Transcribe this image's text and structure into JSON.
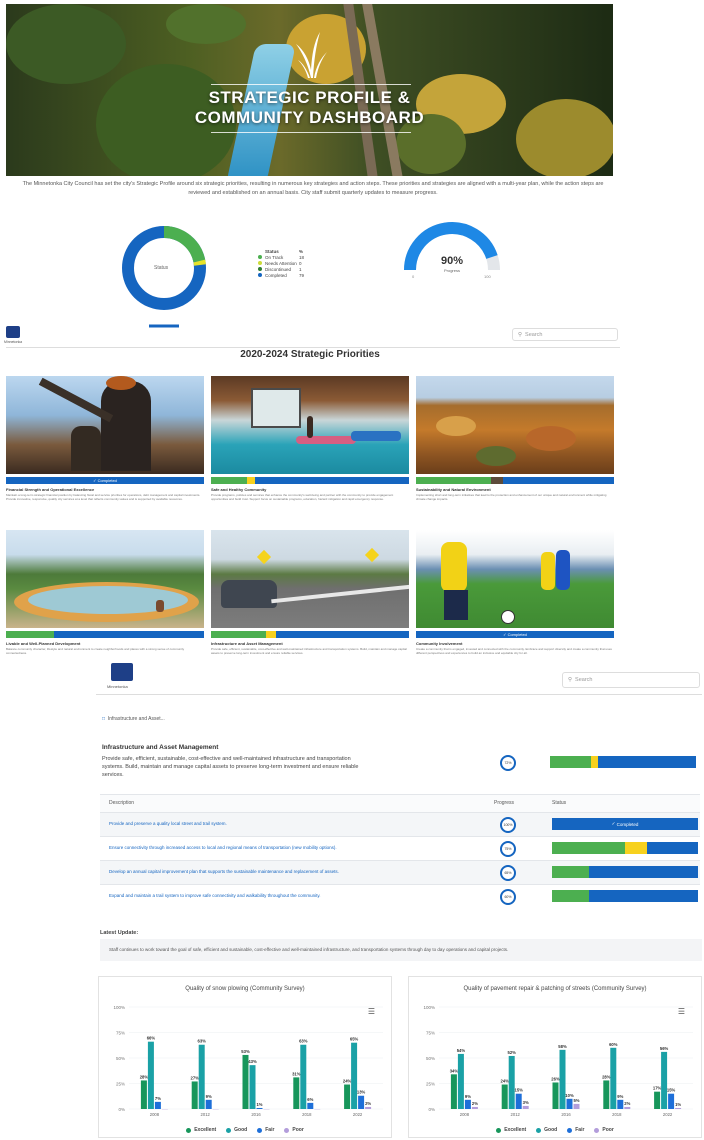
{
  "hero": {
    "title_line1": "STRATEGIC PROFILE &",
    "title_line2": "COMMUNITY DASHBOARD"
  },
  "intro": "The Minnetonka City Council has set the city's Strategic Profile around six strategic priorities, resulting in numerous key strategies and action steps. These priorities and strategies are aligned with a multi-year plan, while the action steps are reviewed and established on an annual basis. City staff submit quarterly updates to measure progress.",
  "status_donut": {
    "center_label": "Status",
    "legend_header": [
      "Status",
      "%"
    ],
    "legend": [
      {
        "label": "On Track",
        "value": "18",
        "color": "#4caf50"
      },
      {
        "label": "Needs Attention",
        "value": "0",
        "color": "#cddc39"
      },
      {
        "label": "Discontinued",
        "value": "1",
        "color": "#2e7d32"
      },
      {
        "label": "Completed",
        "value": "79",
        "color": "#1565c0"
      }
    ]
  },
  "progress_gauge": {
    "value_text": "90%",
    "label": "Progress",
    "min": "0",
    "max": "100",
    "fraction": 0.9
  },
  "site": {
    "logo_text": "Minnetonka",
    "search_placeholder": "Search"
  },
  "priorities": {
    "heading": "2020-2024 Strategic Priorities",
    "cards": [
      {
        "title": "Financial Strength and Operational Excellence",
        "desc": "Maintain a long-term strategic financial position by balancing fiscal and service priorities for operations, debt management and capital investments. Provide innovative, responsive, quality city services at a level that reflects community values and is supported by available resources.",
        "status": "Completed",
        "mode": "complete"
      },
      {
        "title": "Safe and Healthy Community",
        "desc": "Provide programs, policies and services that enhance the community's well-being and partner with the community to provide engagement opportunities and build trust. Support focus on sustainable programs, education, hazard mitigation and rapid emergency response.",
        "status": "",
        "mode": "mixed",
        "green": 0.18,
        "yellow": 0.04
      },
      {
        "title": "Sustainability and Natural Environment",
        "desc": "Implementing short and long-term initiatives that lead to the protection and enhancement of our unique and natural environment while mitigating climate change impacts.",
        "status": "",
        "mode": "mixed",
        "green": 0.38,
        "yellow": 0,
        "dark": 0.06
      },
      {
        "title": "Livable and Well-Planned Development",
        "desc": "Balance community character, lifestyle and natural environment to create neighborhoods and places with a strong sense of community connectedness.",
        "status": "",
        "mode": "mixed",
        "green": 0.24,
        "yellow": 0
      },
      {
        "title": "Infrastructure and Asset Management",
        "desc": "Provide safe, efficient, sustainable, cost-effective and well-maintained infrastructure and transportation systems. Build, maintain and manage capital assets to preserve long-term investment and ensure reliable services.",
        "status": "",
        "mode": "mixed",
        "green": 0.28,
        "yellow": 0.05
      },
      {
        "title": "Community Involvement",
        "desc": "Create a community that is engaged, invested and connected with the community. Embrace and support diversity and create a community that uses different perspectives and experiences to build an inclusive and equitable city for all.",
        "status": "Completed",
        "mode": "complete"
      }
    ]
  },
  "detail": {
    "breadcrumb": "Infrastructure and Asset...",
    "title": "Infrastructure and Asset Management",
    "desc": "Provide safe, efficient, sustainable, cost-effective and well-maintained infrastructure and transportation systems. Build, maintain and manage capital assets to preserve long-term investment and ensure reliable services.",
    "progress": "72%",
    "overall_status": {
      "green": 0.28,
      "yellow": 0.05
    },
    "table_headers": {
      "description": "Description",
      "progress": "Progress",
      "status": "Status"
    },
    "rows": [
      {
        "text": "Provide and preserve a quality local street and trail system.",
        "progress": "100%",
        "status_label": "Completed",
        "mode": "complete"
      },
      {
        "text": "Ensure connectivity through increased access to local and regional means of transportation (new mobility options).",
        "progress": "75%",
        "mode": "mixed",
        "green": 0.5,
        "yellow": 0.15
      },
      {
        "text": "Develop an annual capital improvement plan that supports the sustainable maintenance and replacement of assets.",
        "progress": "65%",
        "mode": "mixed",
        "green": 0.25,
        "yellow": 0
      },
      {
        "text": "Expand and maintain a trail system to improve safe connectivity and walkability throughout the community.",
        "progress": "60%",
        "mode": "mixed",
        "green": 0.25,
        "yellow": 0
      }
    ],
    "latest_label": "Latest Update:",
    "latest_text": "Staff continues to work toward the goal of safe, efficient and sustainable, cost-effective and well-maintained infrastructure, and transportation systems through day to day operations and capital projects."
  },
  "colors": {
    "excellent": "#17965b",
    "good": "#1aa1a6",
    "fair": "#1e6fd9",
    "poor": "#b39ddb",
    "blue": "#1565c0",
    "green": "#4caf50",
    "yellow": "#f7d11e"
  },
  "chart_data": [
    {
      "type": "bar",
      "title": "Quality of snow plowing (Community Survey)",
      "categories": [
        "2008",
        "2012",
        "2016",
        "2018",
        "2022"
      ],
      "ylim": [
        0,
        100
      ],
      "yticks": [
        "0%",
        "25%",
        "50%",
        "75%",
        "100%"
      ],
      "series": [
        {
          "name": "Excellent",
          "values": [
            28,
            27,
            53,
            31,
            24
          ]
        },
        {
          "name": "Good",
          "values": [
            66,
            63,
            43,
            63,
            65
          ]
        },
        {
          "name": "Fair",
          "values": [
            7,
            9,
            1,
            6,
            13
          ]
        },
        {
          "name": "Poor",
          "values": [
            0,
            0,
            0,
            0,
            2
          ]
        }
      ],
      "labels": [
        [
          "28%",
          "66%",
          "7%",
          ""
        ],
        [
          "27%",
          "63%",
          "9%",
          ""
        ],
        [
          "53%",
          "43%",
          "1%",
          ""
        ],
        [
          "31%",
          "63%",
          "6%",
          ""
        ],
        [
          "24%",
          "65%",
          "13%",
          "2%"
        ]
      ]
    },
    {
      "type": "bar",
      "title": "Quality of pavement repair & patching of streets (Community Survey)",
      "categories": [
        "2008",
        "2012",
        "2016",
        "2018",
        "2022"
      ],
      "ylim": [
        0,
        100
      ],
      "yticks": [
        "0%",
        "25%",
        "50%",
        "75%",
        "100%"
      ],
      "series": [
        {
          "name": "Excellent",
          "values": [
            34,
            24,
            26,
            28,
            17
          ]
        },
        {
          "name": "Good",
          "values": [
            54,
            52,
            58,
            60,
            56
          ]
        },
        {
          "name": "Fair",
          "values": [
            9,
            15,
            10,
            9,
            15
          ]
        },
        {
          "name": "Poor",
          "values": [
            2,
            3,
            5,
            2,
            1
          ]
        }
      ],
      "labels": [
        [
          "34%",
          "54%",
          "9%",
          "2%"
        ],
        [
          "24%",
          "52%",
          "15%",
          "3%"
        ],
        [
          "26%",
          "58%",
          "10%",
          "5%"
        ],
        [
          "28%",
          "60%",
          "9%",
          "2%"
        ],
        [
          "17%",
          "56%",
          "15%",
          "1%"
        ]
      ]
    }
  ],
  "chart_legend": [
    "Excellent",
    "Good",
    "Fair",
    "Poor"
  ]
}
